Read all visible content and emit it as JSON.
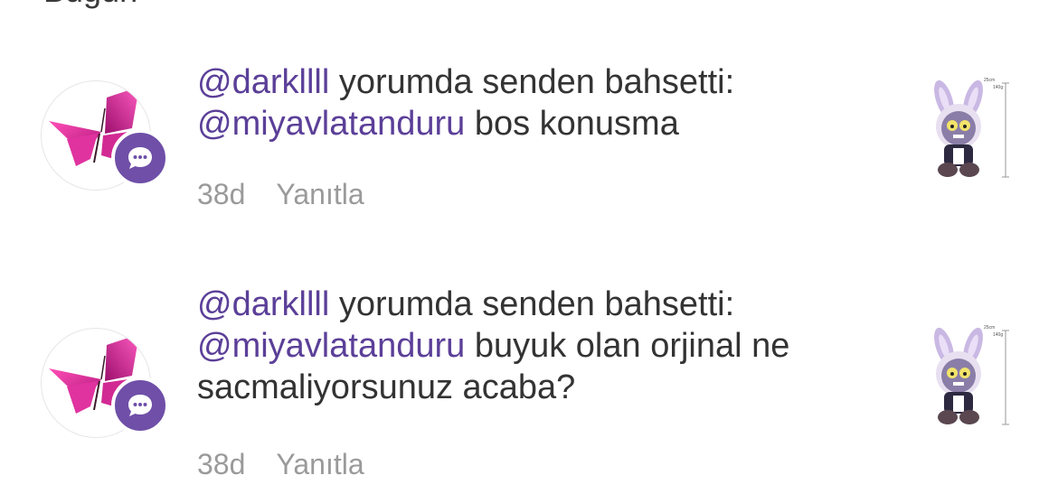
{
  "header": {
    "section_label": "Bugün"
  },
  "notifications": [
    {
      "author": "@darkllll",
      "action": "yorumda senden bahsetti:",
      "mention": "@miyavlatanduru",
      "comment_line1": "bos konusma",
      "comment_line2": "",
      "time": "38d",
      "reply_label": "Yanıtla",
      "thumb_size_label": "25cm",
      "thumb_weight_label": "140g"
    },
    {
      "author": "@darkllll",
      "action": "yorumda senden bahsetti:",
      "mention": "@miyavlatanduru",
      "comment_line1": "buyuk olan orjinal ne",
      "comment_line2": "sacmaliyorsunuz acaba?",
      "time": "38d",
      "reply_label": "Yanıtla",
      "thumb_size_label": "25cm",
      "thumb_weight_label": "140g"
    }
  ],
  "colors": {
    "mention": "#5b3f98",
    "badge": "#6f4fa8",
    "meta": "#9a9a9a"
  },
  "icons": {
    "avatar": "butterfly-icon",
    "badge": "comment-bubble-icon",
    "thumbnail": "plush-toy-image"
  }
}
